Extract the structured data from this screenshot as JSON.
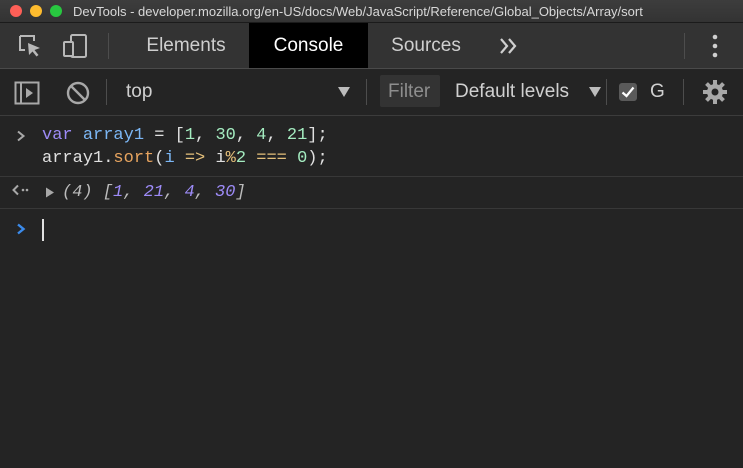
{
  "window": {
    "title": "DevTools - developer.mozilla.org/en-US/docs/Web/JavaScript/Reference/Global_Objects/Array/sort"
  },
  "tabs": [
    {
      "label": "Elements",
      "active": false
    },
    {
      "label": "Console",
      "active": true
    },
    {
      "label": "Sources",
      "active": false
    }
  ],
  "toolbar": {
    "context": "top",
    "filter_placeholder": "Filter",
    "levels": "Default levels",
    "checkbox_label": "G",
    "checkbox_checked": true
  },
  "console": {
    "input_lines": [
      "var array1 = [1, 30, 4, 21];",
      "array1.sort(i => i%2 === 0);"
    ],
    "result": {
      "count": "(4)",
      "values": [
        "1",
        "21",
        "4",
        "30"
      ]
    }
  },
  "colors": {
    "keyword": "#9d8bf7",
    "variable": "#7cb7f5",
    "number": "#a4ecc0",
    "method": "#e7a45f",
    "prompt_blue": "#3b8beb"
  },
  "icons": [
    "inspect-icon",
    "device-toggle-icon",
    "more-tabs-icon",
    "kebab-menu-icon",
    "sidebar-toggle-icon",
    "clear-console-icon",
    "dropdown-arrow-icon",
    "settings-gear-icon"
  ]
}
